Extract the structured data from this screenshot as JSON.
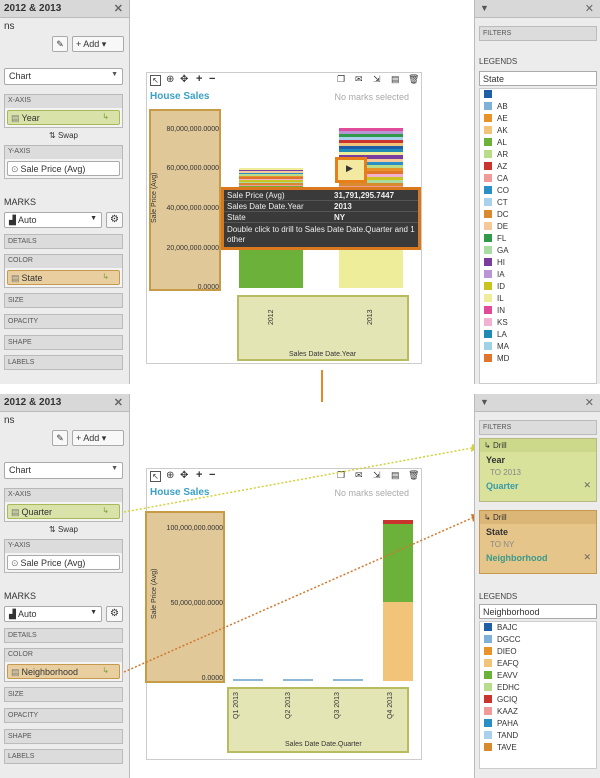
{
  "top": {
    "panel_title": "2012 & 2013",
    "panel_sub": "ns",
    "add_label": "+ Add",
    "chart_type": "Chart",
    "xaxis_header": "X-AXIS",
    "xaxis_pill": "Year",
    "swap_label": "Swap",
    "yaxis_header": "Y-AXIS",
    "yaxis_pill": "Sale Price (Avg)",
    "marks_label": "MARKS",
    "marks_type": "Auto",
    "details_label": "DETAILS",
    "color_header": "COLOR",
    "color_pill": "State",
    "size_label": "SIZE",
    "opacity_label": "OPACITY",
    "shape_label": "SHAPE",
    "labels_label": "LABELS",
    "chart_title": "House Sales",
    "no_marks": "No marks selected",
    "y_ticks": [
      "80,000,000.0000",
      "60,000,000.0000",
      "40,000,000.0000",
      "20,000,000.0000",
      "0.0000"
    ],
    "x_ticks": [
      "2012",
      "2013"
    ],
    "y_label": "Sale Price (Avg)",
    "x_label": "Sales Date Date.Year",
    "tooltip": {
      "r1k": "Sale Price (Avg)",
      "r1v": "31,791,295.7447",
      "r2k": "Sales Date Date.Year",
      "r2v": "2013",
      "r3k": "State",
      "r3v": "NY",
      "foot": "Double click to drill to Sales Date Date.Quarter and 1 other"
    },
    "filters_label": "FILTERS",
    "legends_label": "LEGENDS",
    "legend_field": "State",
    "legend_items": [
      {
        "label": "",
        "color": "#1f5fa8"
      },
      {
        "label": "AB",
        "color": "#7fb0d8"
      },
      {
        "label": "AE",
        "color": "#e8922a"
      },
      {
        "label": "AK",
        "color": "#f2c47a"
      },
      {
        "label": "AL",
        "color": "#6bb13a"
      },
      {
        "label": "AR",
        "color": "#b8dc8a"
      },
      {
        "label": "AZ",
        "color": "#c9342e"
      },
      {
        "label": "CA",
        "color": "#f09a9a"
      },
      {
        "label": "CO",
        "color": "#2b8fc7"
      },
      {
        "label": "CT",
        "color": "#a9d0ec"
      },
      {
        "label": "DC",
        "color": "#d98a2e"
      },
      {
        "label": "DE",
        "color": "#f5c99a"
      },
      {
        "label": "FL",
        "color": "#2e9a4a"
      },
      {
        "label": "GA",
        "color": "#a8dca0"
      },
      {
        "label": "HI",
        "color": "#7a3c9e"
      },
      {
        "label": "IA",
        "color": "#b896d6"
      },
      {
        "label": "ID",
        "color": "#c9c41e"
      },
      {
        "label": "IL",
        "color": "#eeee9a"
      },
      {
        "label": "IN",
        "color": "#e04c9a"
      },
      {
        "label": "KS",
        "color": "#f2b0d2"
      },
      {
        "label": "LA",
        "color": "#1f8ab5"
      },
      {
        "label": "MA",
        "color": "#9fd2e6"
      },
      {
        "label": "MD",
        "color": "#e0742a"
      }
    ]
  },
  "bottom": {
    "panel_title": "2012 & 2013",
    "panel_sub": "ns",
    "add_label": "+ Add",
    "chart_type": "Chart",
    "xaxis_header": "X-AXIS",
    "xaxis_pill": "Quarter",
    "swap_label": "Swap",
    "yaxis_header": "Y-AXIS",
    "yaxis_pill": "Sale Price (Avg)",
    "marks_label": "MARKS",
    "marks_type": "Auto",
    "details_label": "DETAILS",
    "color_header": "COLOR",
    "color_pill": "Neighborhood",
    "size_label": "SIZE",
    "opacity_label": "OPACITY",
    "shape_label": "SHAPE",
    "labels_label": "LABELS",
    "chart_title": "House Sales",
    "no_marks": "No marks selected",
    "y_ticks": [
      "100,000,000.0000",
      "50,000,000.0000",
      "0.0000"
    ],
    "x_ticks": [
      "Q1 2013",
      "Q2 2013",
      "Q3 2013",
      "Q4 2013"
    ],
    "y_label": "Sale Price (Avg)",
    "x_label": "Sales Date Date.Quarter",
    "filters_label": "FILTERS",
    "drill1": {
      "head": "Drill",
      "key": "Year",
      "val": "TO 2013",
      "field": "Quarter"
    },
    "drill2": {
      "head": "Drill",
      "key": "State",
      "val": "TO NY",
      "field": "Neighborhood"
    },
    "legends_label": "LEGENDS",
    "legend_field": "Neighborhood",
    "legend_items": [
      {
        "label": "BAJC",
        "color": "#1f5fa8"
      },
      {
        "label": "DGCC",
        "color": "#7fb0d8"
      },
      {
        "label": "DIEO",
        "color": "#e8922a"
      },
      {
        "label": "EAFQ",
        "color": "#f2c47a"
      },
      {
        "label": "EAVV",
        "color": "#6bb13a"
      },
      {
        "label": "EDHC",
        "color": "#b8dc8a"
      },
      {
        "label": "GCIQ",
        "color": "#c9342e"
      },
      {
        "label": "KAAZ",
        "color": "#f09a9a"
      },
      {
        "label": "PAHA",
        "color": "#2b8fc7"
      },
      {
        "label": "TAND",
        "color": "#a9d0ec"
      },
      {
        "label": "TAVE",
        "color": "#d98a2e"
      }
    ]
  },
  "chart_data": [
    {
      "type": "bar",
      "title": "House Sales",
      "categories": [
        "2012",
        "2013"
      ],
      "xlabel": "Sales Date Date.Year",
      "ylabel": "Sale Price (Avg)",
      "ylim": [
        0,
        80000000
      ],
      "stacked": true,
      "values": [
        60000000,
        80000000
      ]
    },
    {
      "type": "bar",
      "title": "House Sales",
      "categories": [
        "Q1 2013",
        "Q2 2013",
        "Q3 2013",
        "Q4 2013"
      ],
      "xlabel": "Sales Date Date.Quarter",
      "ylabel": "Sale Price (Avg)",
      "ylim": [
        0,
        110000000
      ],
      "stacked": true,
      "series": [
        {
          "name": "EAFQ",
          "values": [
            0,
            0,
            0,
            53000000
          ]
        },
        {
          "name": "EAVV",
          "values": [
            0,
            0,
            0,
            52000000
          ]
        },
        {
          "name": "GCIQ",
          "values": [
            0,
            0,
            0,
            2500000
          ]
        }
      ]
    }
  ]
}
